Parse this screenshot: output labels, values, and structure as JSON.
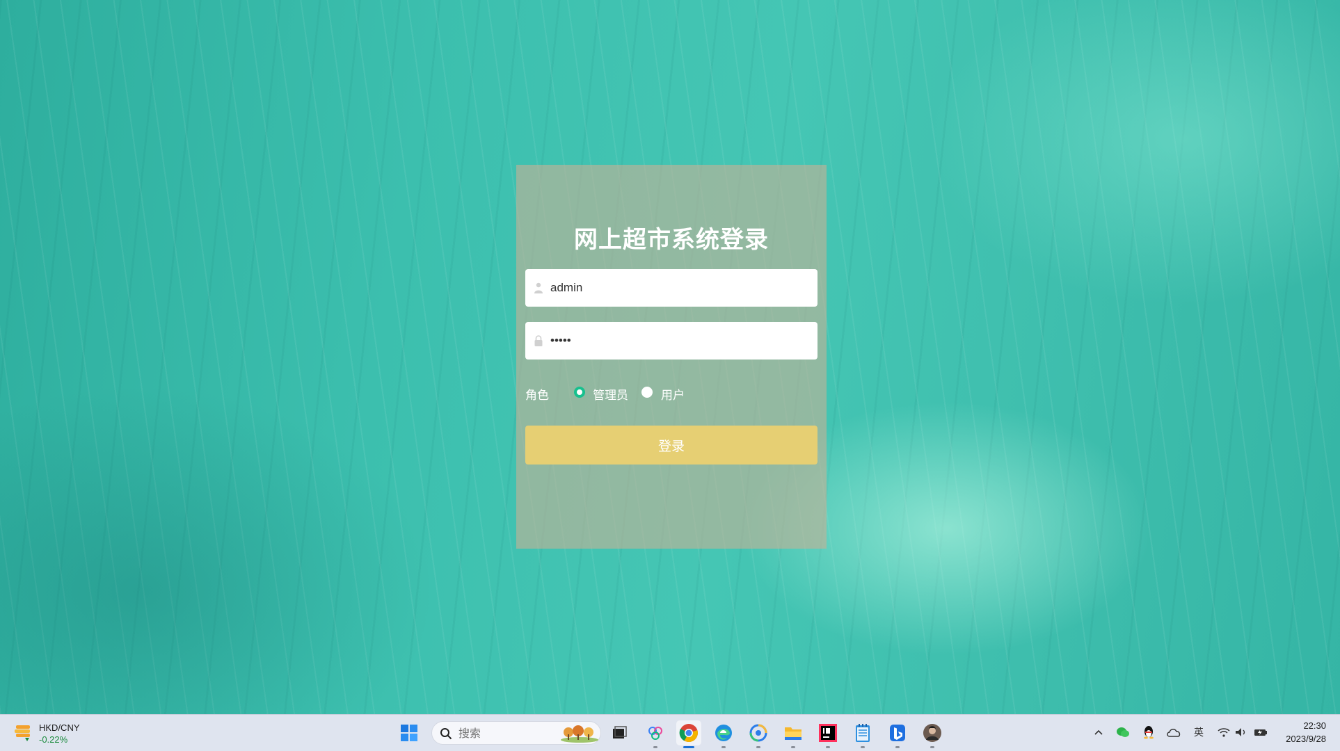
{
  "login": {
    "title": "网上超市系统登录",
    "username_value": "admin",
    "password_value": "•••••",
    "role_label": "角色",
    "role_options": [
      "管理员",
      "用户"
    ],
    "selected_role": "管理员",
    "login_button": "登录",
    "accent_color": "#17c08e",
    "button_color": "#e6cf73"
  },
  "taskbar": {
    "widget": {
      "pair": "HKD/CNY",
      "change": "-0.22%"
    },
    "search_placeholder": "搜索",
    "apps": [
      "start-icon",
      "task-view-icon",
      "copilot-icon",
      "chrome-icon",
      "edge-icon",
      "edge-dev-icon",
      "file-explorer-icon",
      "intellij-icon",
      "notepad-icon",
      "bing-icon",
      "avatar-app-icon"
    ],
    "tray": {
      "ime_label": "英",
      "time": "22:30",
      "date": "2023/9/28"
    }
  }
}
